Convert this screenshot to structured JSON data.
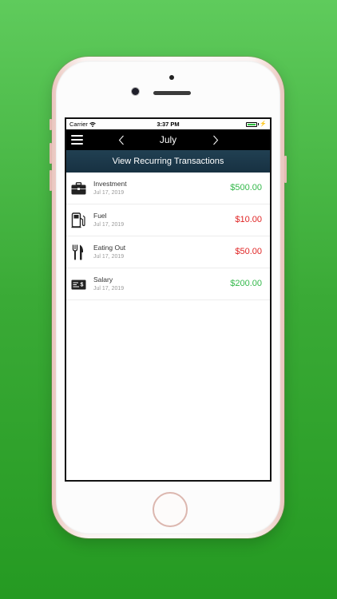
{
  "status_bar": {
    "carrier": "Carrier",
    "time": "3:37 PM"
  },
  "nav": {
    "title": "July",
    "menu_icon": "hamburger-menu-icon",
    "prev_icon": "chevron-left-icon",
    "next_icon": "chevron-right-icon"
  },
  "recurring": {
    "label": "View Recurring Transactions"
  },
  "transactions": [
    {
      "name": "Investment",
      "date": "Jul 17, 2019",
      "amount": "$500.00",
      "type": "income",
      "icon": "briefcase-icon"
    },
    {
      "name": "Fuel",
      "date": "Jul 17, 2019",
      "amount": "$10.00",
      "type": "expense",
      "icon": "fuel-pump-icon"
    },
    {
      "name": "Eating Out",
      "date": "Jul 17, 2019",
      "amount": "$50.00",
      "type": "expense",
      "icon": "fork-knife-icon"
    },
    {
      "name": "Salary",
      "date": "Jul 17, 2019",
      "amount": "$200.00",
      "type": "income",
      "icon": "paycheck-icon"
    }
  ],
  "colors": {
    "background_green": "#3aaa36",
    "income": "#33b84a",
    "expense": "#e02626",
    "header_dark": "#173142",
    "nav_black": "#000000"
  }
}
